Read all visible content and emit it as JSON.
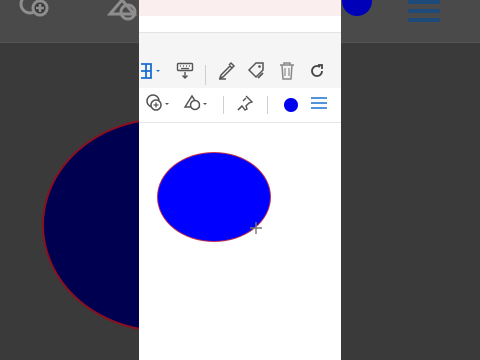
{
  "background": {
    "ellipse_fill": "#000050",
    "ellipse_stroke": "#8a1020",
    "circle_fill": "#0000b8"
  },
  "toolbar_top": {
    "items": [
      {
        "icon": "layout-icon"
      },
      {
        "icon": "keyboard-download-icon"
      },
      {
        "icon": "pen-edit-icon"
      },
      {
        "icon": "tag-edit-icon"
      },
      {
        "icon": "trash-icon"
      },
      {
        "icon": "redo-icon"
      }
    ]
  },
  "toolbar_shape": {
    "items": [
      {
        "icon": "shape-add-icon"
      },
      {
        "icon": "shape-style-icon"
      },
      {
        "icon": "pin-icon"
      },
      {
        "icon": "fill-color-icon",
        "color": "#0000ee"
      },
      {
        "icon": "line-style-icon"
      }
    ]
  },
  "canvas": {
    "shape": {
      "type": "ellipse",
      "fill": "#0000ff",
      "stroke": "#c0304a"
    }
  }
}
